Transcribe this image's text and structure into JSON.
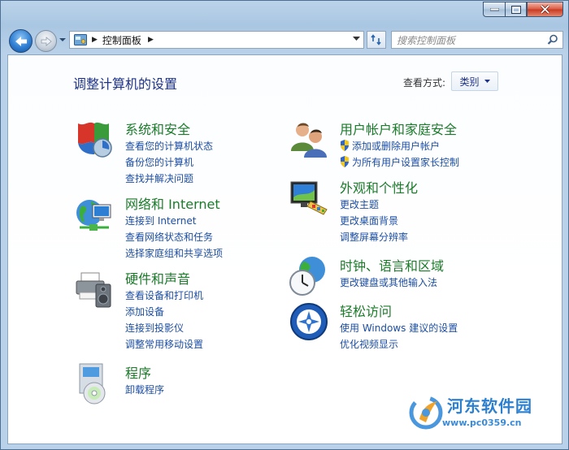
{
  "window": {
    "address": {
      "path": "控制面板"
    },
    "search": {
      "placeholder": "搜索控制面板"
    }
  },
  "page": {
    "title": "调整计算机的设置",
    "view_label": "查看方式:",
    "view_value": "类别"
  },
  "categories": [
    {
      "title": "系统和安全",
      "icon": "security-shield-icon",
      "links": [
        "查看您的计算机状态",
        "备份您的计算机",
        "查找并解决问题"
      ]
    },
    {
      "title": "网络和 Internet",
      "icon": "network-globe-icon",
      "links": [
        "连接到 Internet",
        "查看网络状态和任务",
        "选择家庭组和共享选项"
      ]
    },
    {
      "title": "硬件和声音",
      "icon": "printer-speaker-icon",
      "links": [
        "查看设备和打印机",
        "添加设备",
        "连接到投影仪",
        "调整常用移动设置"
      ]
    },
    {
      "title": "程序",
      "icon": "programs-disc-icon",
      "links": [
        "卸载程序"
      ]
    },
    {
      "title": "用户帐户和家庭安全",
      "icon": "users-icon",
      "links": [
        "添加或删除用户帐户",
        "为所有用户设置家长控制"
      ]
    },
    {
      "title": "外观和个性化",
      "icon": "monitor-palette-icon",
      "links": [
        "更改主题",
        "更改桌面背景",
        "调整屏幕分辨率"
      ]
    },
    {
      "title": "时钟、语言和区域",
      "icon": "clock-globe-icon",
      "links": [
        "更改键盘或其他输入法"
      ]
    },
    {
      "title": "轻松访问",
      "icon": "ease-of-access-icon",
      "links": [
        "使用 Windows 建议的设置",
        "优化视频显示"
      ]
    }
  ],
  "watermark": {
    "title": "河东软件园",
    "url": "www.pc0359.cn"
  }
}
